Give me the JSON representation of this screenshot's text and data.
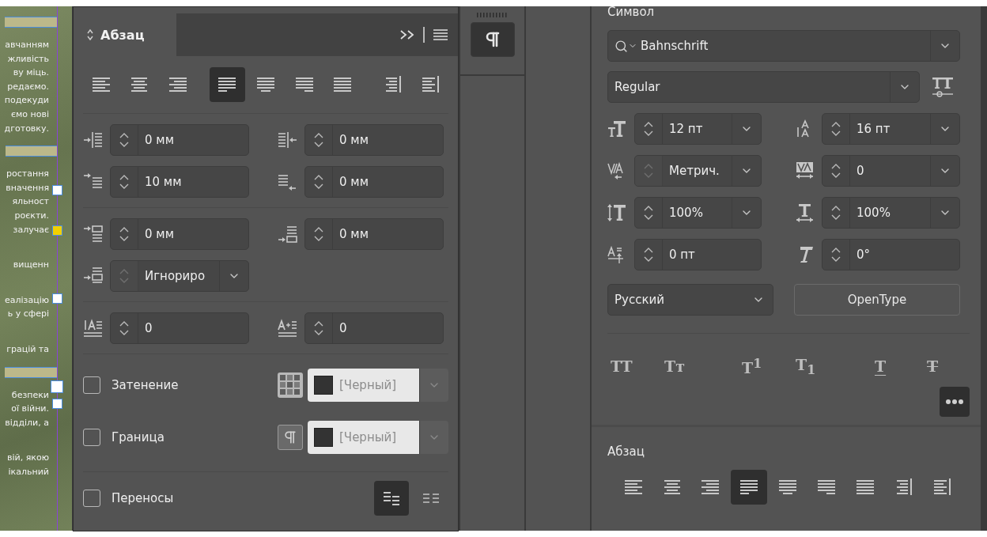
{
  "document": {
    "paragraphs": [
      {
        "band_before": true,
        "lines": [
          "авчанням",
          "жливість",
          "ву міць.",
          "редаємо.",
          "подекуди",
          "ємо нові",
          "дготовку."
        ]
      },
      {
        "band_before": true,
        "lines": [
          "ростання",
          "вначення",
          "яльност",
          "роєкти.",
          "залучає"
        ]
      },
      {
        "band_before": false,
        "lines": [
          "вищенн"
        ]
      },
      {
        "band_before": false,
        "lines": [
          "еалізацію",
          "ь у сфері"
        ]
      },
      {
        "band_before": false,
        "lines": [
          "грацій та"
        ]
      },
      {
        "band_before": true,
        "lines": [
          "безпеки",
          "ої війни.",
          "відділи, а"
        ]
      },
      {
        "band_before": false,
        "lines": [
          "вій, якою",
          "ікальний"
        ]
      }
    ]
  },
  "paragraph_panel": {
    "title": "Абзац",
    "alignment": [
      {
        "kind": "left",
        "selected": false
      },
      {
        "kind": "center",
        "selected": false
      },
      {
        "kind": "right",
        "selected": false
      },
      {
        "kind": "justify_left",
        "selected": true
      },
      {
        "kind": "justify_center",
        "selected": false
      },
      {
        "kind": "justify_right",
        "selected": false
      },
      {
        "kind": "justify_all",
        "selected": false
      },
      {
        "kind": "toward_spine",
        "selected": false
      },
      {
        "kind": "away_spine",
        "selected": false
      }
    ],
    "field_groups": [
      [
        {
          "kind": "indent_left",
          "value": "0 мм",
          "dropdown": false,
          "disabled": false
        },
        {
          "kind": "indent_right",
          "value": "0 мм",
          "dropdown": false,
          "disabled": false
        },
        {
          "kind": "first_line",
          "value": "10 мм",
          "dropdown": false,
          "disabled": false
        },
        {
          "kind": "last_line",
          "value": "0 мм",
          "dropdown": false,
          "disabled": false
        }
      ],
      [
        {
          "kind": "space_before",
          "value": "0 мм",
          "dropdown": false,
          "disabled": false
        },
        {
          "kind": "space_after",
          "value": "0 мм",
          "dropdown": false,
          "disabled": false
        },
        {
          "kind": "grid",
          "value": "Игнориро",
          "dropdown": true,
          "disabled": true
        }
      ],
      [
        {
          "kind": "drop_lines",
          "value": "0",
          "dropdown": false,
          "disabled": false
        },
        {
          "kind": "drop_chars",
          "value": "0",
          "dropdown": false,
          "disabled": false
        }
      ]
    ],
    "options": [
      {
        "kind": "shading",
        "label": "Затенение",
        "checked": false,
        "swatch": "[Черный]"
      },
      {
        "kind": "border",
        "label": "Граница",
        "checked": false,
        "swatch": "[Черный]"
      }
    ],
    "hyphenation": {
      "label": "Переносы",
      "checked": false,
      "modes": [
        {
          "kind": "paragraph",
          "selected": true
        },
        {
          "kind": "single",
          "selected": false
        }
      ]
    }
  },
  "properties_panel": {
    "section_title": "Символ",
    "font_family": "Bahnschrift",
    "font_style": "Regular",
    "fields": [
      {
        "kind": "size",
        "value": "12 пт",
        "dropdown": true,
        "disabled": false
      },
      {
        "kind": "leading",
        "value": "16 пт",
        "dropdown": true,
        "disabled": false
      },
      {
        "kind": "kerning",
        "value": "Метрич.",
        "dropdown": true,
        "disabled": true
      },
      {
        "kind": "tracking",
        "value": "0",
        "dropdown": true,
        "disabled": false
      },
      {
        "kind": "vscale",
        "value": "100%",
        "dropdown": true,
        "disabled": false
      },
      {
        "kind": "hscale",
        "value": "100%",
        "dropdown": true,
        "disabled": false
      },
      {
        "kind": "baseline",
        "value": "0 пт",
        "dropdown": false,
        "disabled": false
      },
      {
        "kind": "skew",
        "value": "0°",
        "dropdown": false,
        "disabled": false
      }
    ],
    "language": "Русский",
    "opentype_button": "OpenType",
    "styles": [
      {
        "kind": "plain",
        "label": "TT"
      },
      {
        "kind": "plain",
        "label": "Tᴛ"
      },
      {
        "kind": "plain",
        "label": "T$^{1}$"
      },
      {
        "kind": "plain",
        "label": "T$_{1}$"
      },
      {
        "kind": "underline",
        "label": "T"
      },
      {
        "kind": "strike",
        "label": "T"
      }
    ],
    "paragraph_title": "Абзац",
    "alignment": [
      {
        "kind": "left",
        "selected": false
      },
      {
        "kind": "center",
        "selected": false
      },
      {
        "kind": "right",
        "selected": false
      },
      {
        "kind": "justify_left",
        "selected": true
      },
      {
        "kind": "justify_center",
        "selected": false
      },
      {
        "kind": "justify_right",
        "selected": false
      },
      {
        "kind": "justify_all",
        "selected": false
      },
      {
        "kind": "toward_spine",
        "selected": false
      },
      {
        "kind": "away_spine",
        "selected": false
      }
    ]
  }
}
